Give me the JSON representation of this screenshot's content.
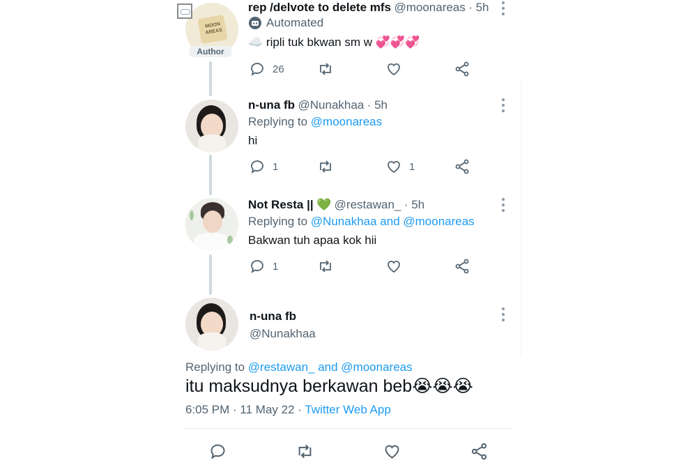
{
  "tweets": [
    {
      "name": "rep /delvote to delete mfs",
      "handle": "@moonareas",
      "time": "· 5h",
      "label": "Automated",
      "badge": "Author",
      "avatar_text": "MOON AREAS",
      "body_emoji_prefix": "☁️",
      "body": "ripli tuk bkwan sm w",
      "body_emoji_suffix": "💞💞💞",
      "reply_count": "26",
      "like_count": ""
    },
    {
      "name": "n-una fb",
      "handle": "@Nunakhaa",
      "time": "· 5h",
      "replying_prefix": "Replying to",
      "replying_to": "@moonareas",
      "body": "hi",
      "reply_count": "1",
      "like_count": "1"
    },
    {
      "name": "Not Resta ||",
      "name_emoji": "💚",
      "handle": "@restawan_",
      "time": "· 5h",
      "replying_prefix": "Replying to",
      "replying_to": "@Nunakhaa and @moonareas",
      "body": "Bakwan tuh apaa kok hii",
      "reply_count": "1",
      "like_count": ""
    }
  ],
  "main_tweet": {
    "name": "n-una fb",
    "handle": "@Nunakhaa",
    "replying_prefix": "Replying to",
    "replying_to": "@restawan_ and @moonareas",
    "body": "itu maksudnya berkawan beb",
    "body_emoji": "😭😭😭",
    "timestamp": "6:05 PM · 11 May 22 ·",
    "source": "Twitter Web App"
  },
  "colors": {
    "accent": "#1d9bf0",
    "text": "#0f1419",
    "muted": "#536471",
    "thread_line": "#cfd9de"
  },
  "icons": [
    "reply-icon",
    "retweet-icon",
    "like-icon",
    "share-icon",
    "more-icon",
    "bot-icon"
  ]
}
